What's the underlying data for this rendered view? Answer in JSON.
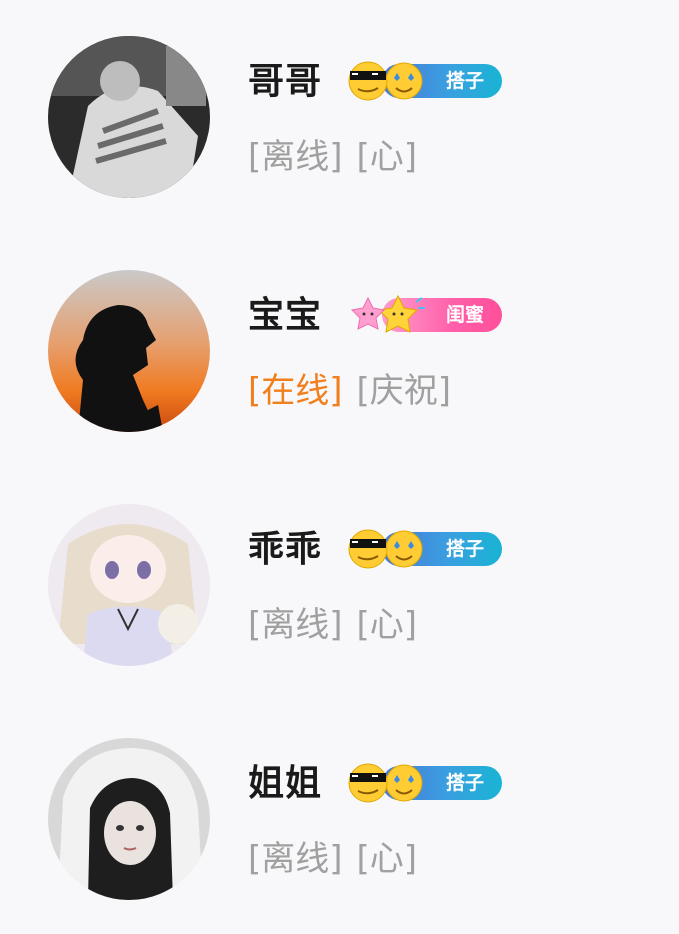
{
  "contacts": [
    {
      "name": "哥哥",
      "badge_label": "搭子",
      "badge_color": "#3a9fe0",
      "badge_emoji": "cool-sunglasses-star-eyes-emoji",
      "status": "[离线]",
      "status_online": false,
      "mood": "[心]"
    },
    {
      "name": "宝宝",
      "badge_label": "闺蜜",
      "badge_color": "#ff5fa9",
      "badge_emoji": "pink-and-yellow-stars-emoji",
      "status": "[在线]",
      "status_online": true,
      "mood": "[庆祝]"
    },
    {
      "name": "乖乖",
      "badge_label": "搭子",
      "badge_color": "#3a9fe0",
      "badge_emoji": "cool-sunglasses-star-eyes-emoji",
      "status": "[离线]",
      "status_online": false,
      "mood": "[心]"
    },
    {
      "name": "姐姐",
      "badge_label": "搭子",
      "badge_color": "#3a9fe0",
      "badge_emoji": "cool-sunglasses-star-eyes-emoji",
      "status": "[离线]",
      "status_online": false,
      "mood": "[心]"
    }
  ]
}
